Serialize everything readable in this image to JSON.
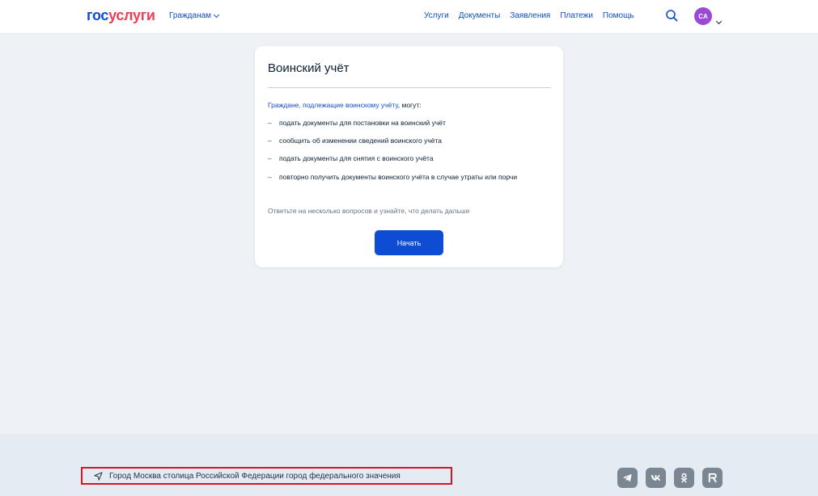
{
  "header": {
    "logo_part1": "гос",
    "logo_part2": "услуги",
    "audience": "Гражданам",
    "nav": [
      "Услуги",
      "Документы",
      "Заявления",
      "Платежи",
      "Помощь"
    ],
    "avatar_initials": "CA"
  },
  "card": {
    "title": "Воинский учёт",
    "intro_link": "Граждане, подлежащие воинскому учёту",
    "intro_rest": ", могут:",
    "options": [
      "подать документы для постановки на воинский учёт",
      "сообщить об изменении сведений воинского учёта",
      "подать документы для снятия с воинского учёта",
      "повторно получить документы воинского учёта в случае утраты или порчи"
    ],
    "hint": "Ответьте на несколько вопросов и узнайте, что делать дальше",
    "button_label": "Начать"
  },
  "footer": {
    "location": "Город Москва столица Российской Федерации город федерального значения",
    "socials": [
      "telegram-icon",
      "vk-icon",
      "odnoklassniki-icon",
      "rutube-icon"
    ]
  },
  "colors": {
    "brand_blue": "#0d4cd3",
    "brand_red": "#ee3f58",
    "avatar": "#9a4ad8",
    "highlight": "#e0121b"
  }
}
